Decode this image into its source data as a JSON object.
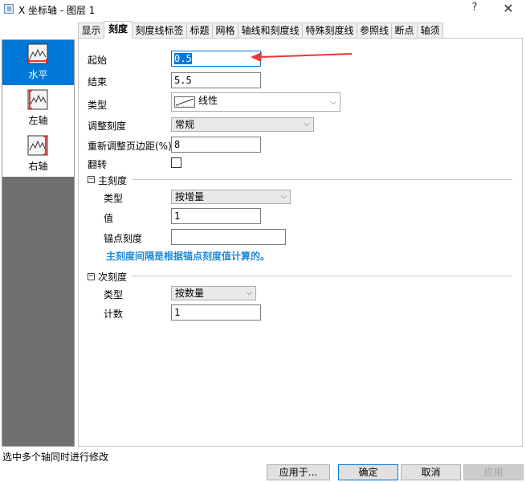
{
  "window": {
    "title": "X 坐标轴 - 图层 1",
    "help": "?",
    "close": "✕"
  },
  "tabs": [
    {
      "label": "显示"
    },
    {
      "label": "刻度"
    },
    {
      "label": "刻度线标签"
    },
    {
      "label": "标题"
    },
    {
      "label": "网格"
    },
    {
      "label": "轴线和刻度线"
    },
    {
      "label": "特殊刻度线"
    },
    {
      "label": "参照线"
    },
    {
      "label": "断点"
    },
    {
      "label": "轴须"
    }
  ],
  "active_tab": "刻度",
  "axes": [
    {
      "label": "水平",
      "icon": "horizontal-axis-icon",
      "selected": true
    },
    {
      "label": "左轴",
      "icon": "left-axis-icon",
      "selected": false
    },
    {
      "label": "右轴",
      "icon": "right-axis-icon",
      "selected": false
    }
  ],
  "scale": {
    "from_label": "起始",
    "from_value": "0.5",
    "to_label": "结束",
    "to_value": "5.5",
    "type_label": "类型",
    "type_value": "线性",
    "rescale_label": "调整刻度",
    "rescale_value": "常规",
    "margin_label": "重新调整页边距(%)",
    "margin_value": "8",
    "reverse_label": "翻转",
    "reverse_checked": false
  },
  "major": {
    "group_label": "主刻度",
    "type_label": "类型",
    "type_value": "按增量",
    "value_label": "值",
    "value_value": "1",
    "anchor_label": "锚点刻度",
    "anchor_value": "",
    "hint": "主刻度间隔是根据锚点刻度值计算的。"
  },
  "minor": {
    "group_label": "次刻度",
    "type_label": "类型",
    "type_value": "按数量",
    "count_label": "计数",
    "count_value": "1"
  },
  "status": "选中多个轴同时进行修改",
  "buttons": {
    "apply_to": "应用于...",
    "ok": "确定",
    "cancel": "取消",
    "apply": "应用"
  },
  "colors": {
    "accent": "#0078d7",
    "hint": "#1e8ad8",
    "annotation_arrow": "#e53935",
    "sidebar": "#6f6f6f"
  }
}
